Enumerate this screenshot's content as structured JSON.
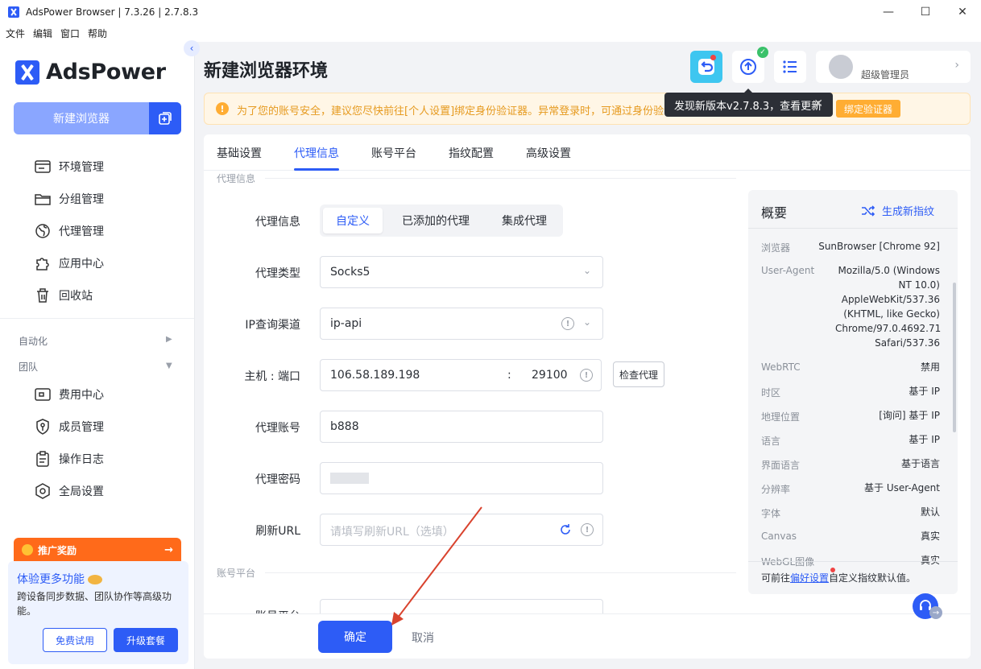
{
  "window": {
    "title": "AdsPower Browser | 7.3.26 | 2.7.8.3",
    "minimize": "—",
    "maximize": "☐",
    "close": "✕"
  },
  "menu": [
    "文件",
    "编辑",
    "窗口",
    "帮助"
  ],
  "sidebar": {
    "logo": "AdsPower",
    "new_browser": "新建浏览器",
    "items": [
      {
        "label": "环境管理",
        "icon": "browser-window-icon"
      },
      {
        "label": "分组管理",
        "icon": "folder-icon"
      },
      {
        "label": "代理管理",
        "icon": "globe-icon"
      },
      {
        "label": "应用中心",
        "icon": "puzzle-icon"
      },
      {
        "label": "回收站",
        "icon": "trash-icon"
      }
    ],
    "section_automation": "自动化",
    "section_team": "团队",
    "team_items": [
      {
        "label": "费用中心",
        "icon": "wallet-icon"
      },
      {
        "label": "成员管理",
        "icon": "shield-user-icon"
      },
      {
        "label": "操作日志",
        "icon": "clipboard-icon"
      },
      {
        "label": "全局设置",
        "icon": "settings-icon"
      }
    ],
    "promo": "推广奖励",
    "promo_arrow": "→",
    "upgrade": {
      "title": "体验更多功能",
      "desc": "跨设备同步数据、团队协作等高级功能。",
      "free_trial": "免费试用",
      "upgrade": "升级套餐"
    }
  },
  "header": {
    "title": "新建浏览器环境",
    "user": "超级管理员",
    "tooltip": "发现新版本v2.7.8.3，查看更新"
  },
  "alert": {
    "text": "为了您的账号安全，建议您尽快前往[个人设置]绑定身份验证器。异常登录时，可通过身份验证",
    "button": "绑定验证器"
  },
  "tabs": [
    "基础设置",
    "代理信息",
    "账号平台",
    "指纹配置",
    "高级设置"
  ],
  "form": {
    "group_proxy": "代理信息",
    "proxy_label": "代理信息",
    "proxy_options": [
      "自定义",
      "已添加的代理",
      "集成代理"
    ],
    "type_label": "代理类型",
    "type_value": "Socks5",
    "ip_label": "IP查询渠道",
    "ip_value": "ip-api",
    "host_label": "主机 : 端口",
    "host_value": "106.58.189.198",
    "colon": ":",
    "port_value": "29100",
    "check_btn": "检查代理",
    "account_label": "代理账号",
    "account_value": "b888",
    "password_label": "代理密码",
    "refresh_label": "刷新URL",
    "refresh_placeholder": "请填写刷新URL（选填）",
    "group_account": "账号平台",
    "platform_label": "账号平台"
  },
  "summary": {
    "title": "概要",
    "generate": "生成新指纹",
    "rows": [
      {
        "label": "浏览器",
        "value": "SunBrowser [Chrome 92]"
      },
      {
        "label": "User-Agent",
        "value": "Mozilla/5.0 (Windows NT 10.0) AppleWebKit/537.36 (KHTML, like Gecko) Chrome/97.0.4692.71 Safari/537.36"
      },
      {
        "label": "WebRTC",
        "value": "禁用"
      },
      {
        "label": "时区",
        "value": "基于 IP"
      },
      {
        "label": "地理位置",
        "value": "[询问] 基于 IP"
      },
      {
        "label": "语言",
        "value": "基于 IP"
      },
      {
        "label": "界面语言",
        "value": "基于语言"
      },
      {
        "label": "分辨率",
        "value": "基于 User-Agent"
      },
      {
        "label": "字体",
        "value": "默认"
      },
      {
        "label": "Canvas",
        "value": "真实"
      },
      {
        "label": "WebGL图像",
        "value": "真实"
      }
    ],
    "foot_prefix": "可前往",
    "foot_link": "偏好设置",
    "foot_suffix": "自定义指纹默认值。"
  },
  "footer": {
    "ok": "确定",
    "cancel": "取消"
  }
}
